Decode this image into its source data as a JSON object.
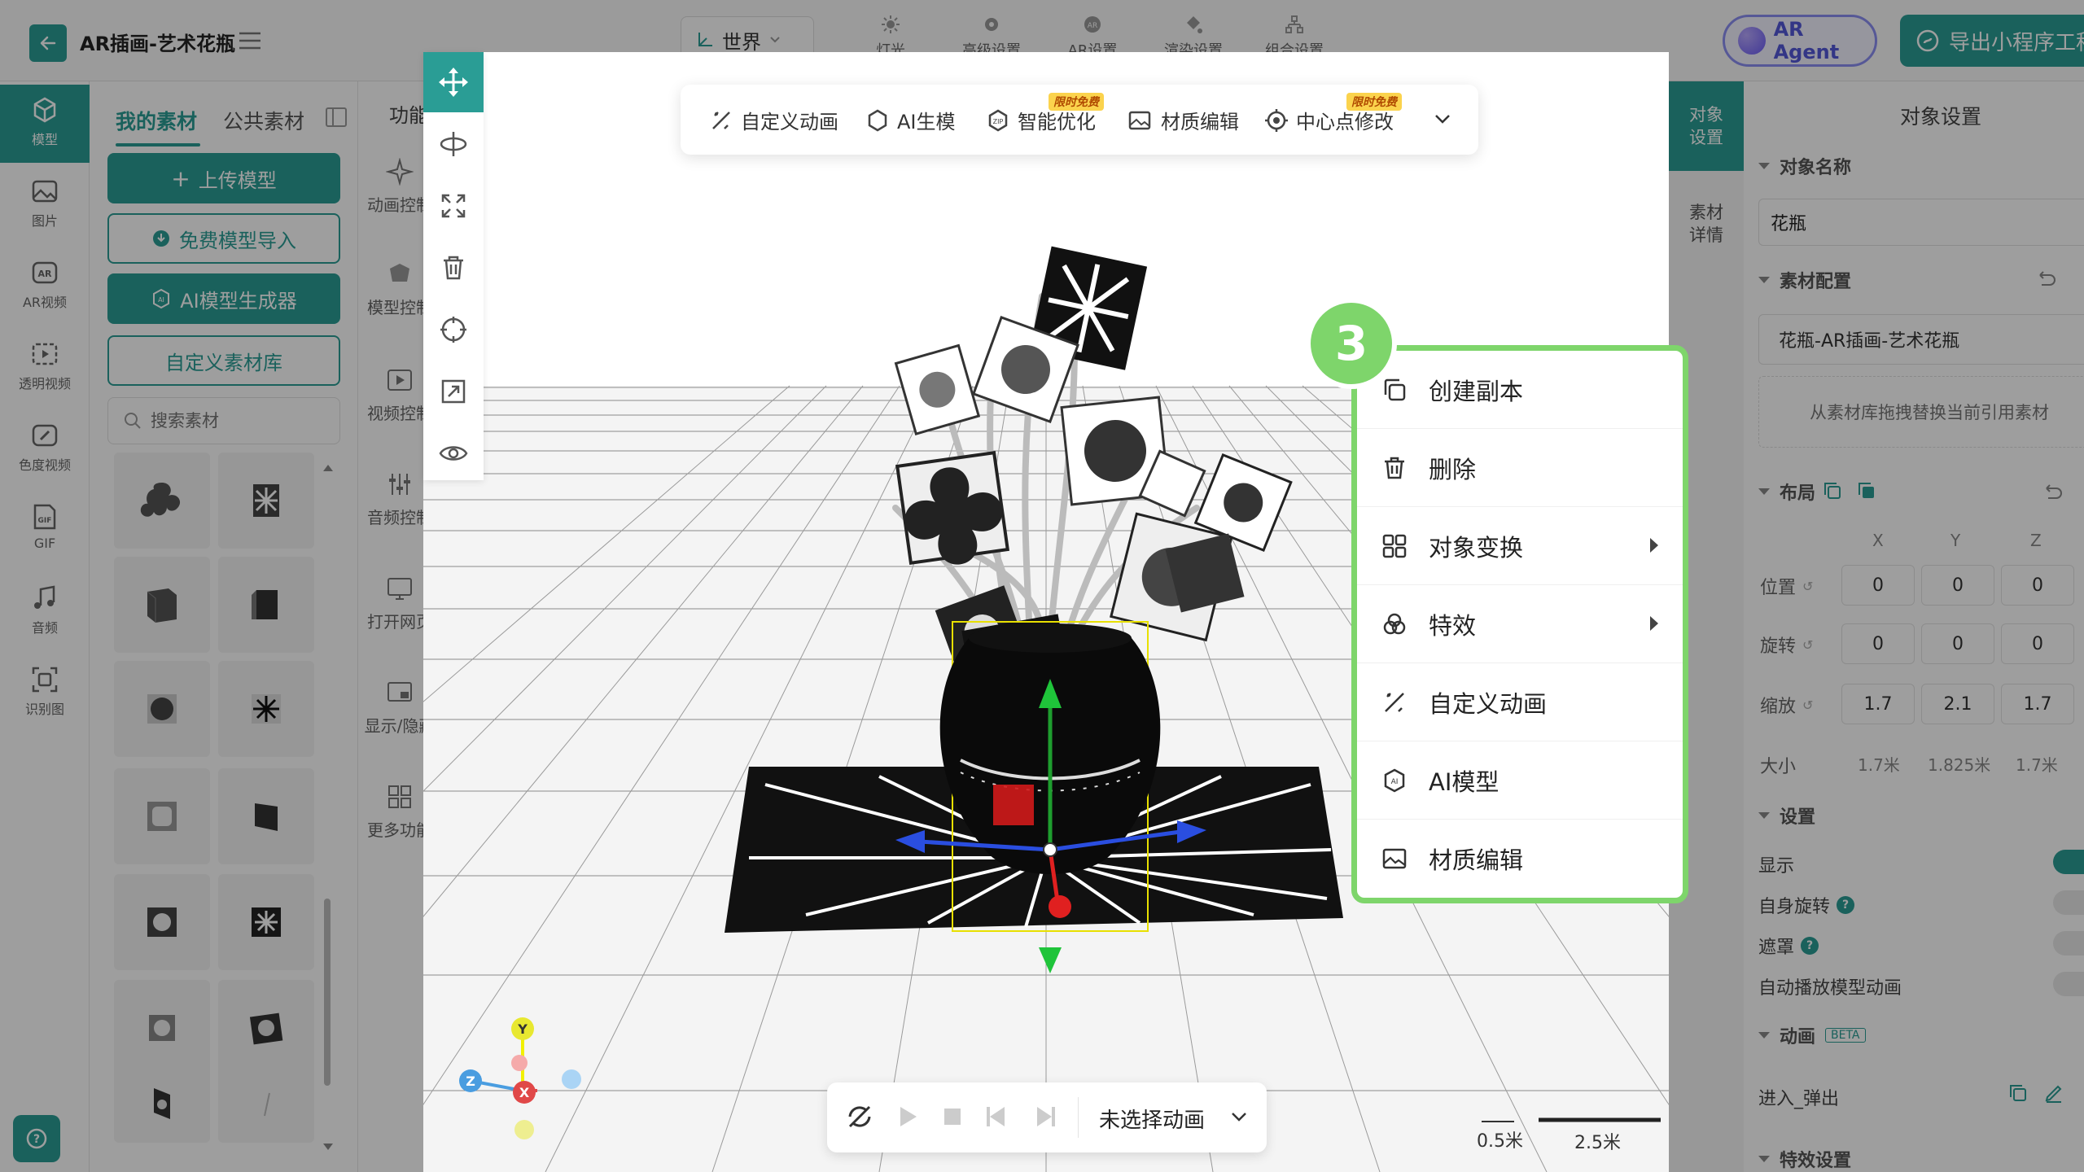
{
  "app": {
    "title": "AR插画-艺术花瓶"
  },
  "header": {
    "world_select": "世界",
    "tools": [
      {
        "label": "灯光",
        "icon": "light-icon"
      },
      {
        "label": "高级设置",
        "icon": "gear-icon"
      },
      {
        "label": "AR设置",
        "icon": "ar-icon"
      },
      {
        "label": "渲染设置",
        "icon": "paint-icon"
      },
      {
        "label": "组合设置",
        "icon": "hierarchy-icon"
      }
    ],
    "ar_agent": "AR Agent",
    "export": "导出小程序工程"
  },
  "left_rail": [
    {
      "label": "模型",
      "icon": "cube-icon"
    },
    {
      "label": "图片",
      "icon": "image-icon"
    },
    {
      "label": "AR视频",
      "icon": "ar-video-icon"
    },
    {
      "label": "透明视频",
      "icon": "transparent-video-icon"
    },
    {
      "label": "色度视频",
      "icon": "chroma-video-icon"
    },
    {
      "label": "GIF",
      "icon": "gif-icon"
    },
    {
      "label": "音频",
      "icon": "music-icon"
    },
    {
      "label": "识别图",
      "icon": "recognize-icon"
    }
  ],
  "materials": {
    "tabs": [
      "我的素材",
      "公共素材"
    ],
    "upload": "上传模型",
    "free_import": "免费模型导入",
    "ai_generator": "AI模型生成器",
    "custom_library": "自定义素材库",
    "search_placeholder": "搜索素材"
  },
  "functions": {
    "head": "功能",
    "items": [
      "动画控制",
      "模型控制",
      "视频控制",
      "音频控制",
      "打开网页",
      "显示/隐藏",
      "更多功能"
    ]
  },
  "float_toolbar": {
    "items": [
      "自定义动画",
      "AI生模",
      "智能优化",
      "材质编辑",
      "中心点修改"
    ],
    "badge": "限时免费"
  },
  "animation_bar": {
    "label": "未选择动画"
  },
  "scale": {
    "small": "0.5米",
    "large": "2.5米"
  },
  "context_menu": {
    "step": "3",
    "items": [
      {
        "label": "创建副本",
        "icon": "copy-icon",
        "submenu": false
      },
      {
        "label": "删除",
        "icon": "trash-icon",
        "submenu": false
      },
      {
        "label": "对象变换",
        "icon": "grid-icon",
        "submenu": true
      },
      {
        "label": "特效",
        "icon": "effects-icon",
        "submenu": true
      },
      {
        "label": "自定义动画",
        "icon": "animation-icon",
        "submenu": false
      },
      {
        "label": "AI模型",
        "icon": "ai-model-icon",
        "submenu": false
      },
      {
        "label": "材质编辑",
        "icon": "material-icon",
        "submenu": false
      }
    ]
  },
  "right_tabs": [
    "对象设置",
    "素材详情"
  ],
  "settings": {
    "title": "对象设置",
    "object_name_label": "对象名称",
    "object_name": "花瓶",
    "material_config_label": "素材配置",
    "material_value": "花瓶-AR插画-艺术花瓶",
    "drag_hint": "从素材库拖拽替换当前引用素材",
    "layout_label": "布局",
    "axes": [
      "X",
      "Y",
      "Z"
    ],
    "position_label": "位置",
    "position": [
      "0",
      "0",
      "0"
    ],
    "rotation_label": "旋转",
    "rotation": [
      "0",
      "0",
      "0"
    ],
    "scale_label": "缩放",
    "scale": [
      "1.7",
      "2.1",
      "1.7"
    ],
    "size_label": "大小",
    "size": [
      "1.7米",
      "1.825米",
      "1.7米"
    ],
    "settings_label": "设置",
    "show_label": "显示",
    "self_rotate_label": "自身旋转",
    "mask_label": "遮罩",
    "autoplay_label": "自动播放模型动画",
    "animation_label": "动画",
    "beta": "BETA",
    "animation_entry": "进入_弹出",
    "effects_label": "特效设置"
  },
  "colors": {
    "accent": "#2a9d95",
    "highlight": "#7ed56b",
    "badge": "#fbd34d"
  }
}
